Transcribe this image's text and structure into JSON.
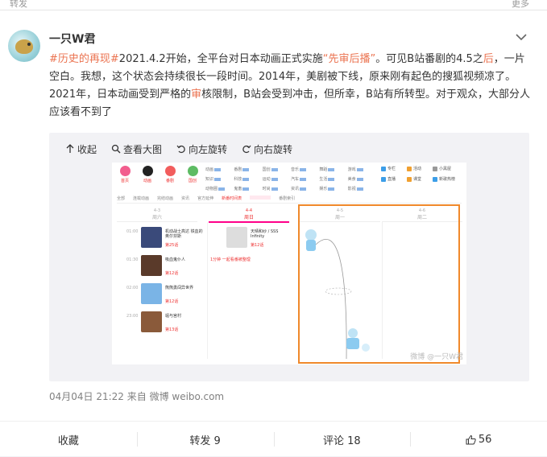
{
  "top_strip": {
    "left_label": "转发",
    "right_label": "更多"
  },
  "post": {
    "username": "一只W君",
    "text": {
      "topic": "#历史的再现#",
      "part1": "2021.4.2开始，全平台对日本动画正式实施",
      "link1": "“先审后播”",
      "part2": "。可见B站番剧的4.5之",
      "link2": "后",
      "part3": "，一片空白。我想，这个状态会持续很长一段时间。2014年，美剧被下线，原来刚有起色的搜狐视频凉了。2021年，日本动画受到严格的",
      "link3": "审",
      "part4": "核限制，B站会受到冲击，但所幸，B站有所转型。对于观众，大部分人应该看不到了"
    },
    "meta": "04月04日 21:22  来自 微博 weibo.com"
  },
  "image_toolbar": {
    "collapse": "收起",
    "view_large": "查看大图",
    "rotate_left": "向左旋转",
    "rotate_right": "向右旋转"
  },
  "screenshot": {
    "categories": [
      {
        "label": "首页",
        "color": "#f25d8e"
      },
      {
        "label": "动画",
        "color": "#222222"
      },
      {
        "label": "番剧",
        "color": "#f25d5d"
      },
      {
        "label": "国创",
        "color": "#5dbb63"
      }
    ],
    "tags": [
      "动画",
      "番剧",
      "国创",
      "音乐",
      "舞蹈",
      "游戏",
      "知识",
      "科技",
      "运动",
      "汽车",
      "生活",
      "美食",
      "动物圈",
      "鬼畜",
      "时尚",
      "资讯",
      "娱乐",
      "影视"
    ],
    "right_links": [
      {
        "label": "专栏",
        "color": "#3c9ee8"
      },
      {
        "label": "活动",
        "color": "#f0a030"
      },
      {
        "label": "小黑屋",
        "color": "#999999"
      },
      {
        "label": "直播",
        "color": "#3c9ee8"
      },
      {
        "label": "课堂",
        "color": "#f0a030"
      },
      {
        "label": "新歌热榜",
        "color": "#3c9ee8"
      }
    ],
    "subnav": [
      "全部",
      "连载动画",
      "完结动画",
      "资讯",
      "官方延伸",
      "新番时间表",
      "番剧索引"
    ],
    "days": [
      {
        "date": "4-3",
        "week": "周六"
      },
      {
        "date": "4-4",
        "week": "周日"
      },
      {
        "date": "4-5",
        "week": "周一"
      },
      {
        "date": "4-6",
        "week": "周二"
      }
    ],
    "entries_col1": [
      {
        "time": "01:00",
        "title": "机动战士高达 铁血的奥尔芬斯",
        "ep": "第25话",
        "color": "#3a4a7a"
      },
      {
        "time": "01:30",
        "title": "吸血鬼仆人",
        "ep": "第12话",
        "color": "#5a3a2a"
      },
      {
        "time": "02:00",
        "title": "熊熊勇闯异世界",
        "ep": "第12话",
        "color": "#7ab4e6"
      },
      {
        "time": "23:00",
        "title": "堀与宫村",
        "ep": "第13话",
        "color": "#8a5a3a"
      }
    ],
    "entries_col2": [
      {
        "time": "",
        "title": "天晴和纱 / SSS Infinity",
        "ep": "第12话",
        "color": "#dddddd"
      }
    ],
    "col2_note": "1分钟 一起看番被整理",
    "watermark": "微博 @一只W君"
  },
  "actions": {
    "favorite": "收藏",
    "repost": "转发 9",
    "comment": "评论 18",
    "like": "56"
  }
}
